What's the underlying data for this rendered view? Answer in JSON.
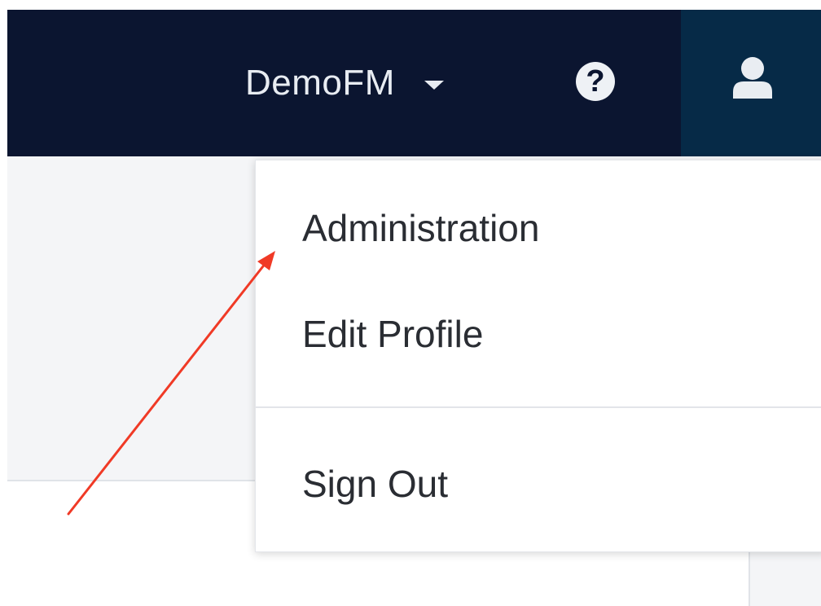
{
  "navbar": {
    "org_name": "DemoFM",
    "help_symbol": "?",
    "icons": {
      "dropdown": "caret-down-icon",
      "help": "question-circle-icon",
      "user": "user-icon"
    }
  },
  "user_menu": {
    "items": [
      {
        "label": "Administration"
      },
      {
        "label": "Edit Profile"
      },
      {
        "label": "Sign Out"
      }
    ]
  },
  "annotation": {
    "type": "arrow",
    "color": "#f03a26"
  },
  "colors": {
    "navbar_bg": "#0b1530",
    "user_button_bg": "#062a47",
    "content_bg": "#f4f5f7",
    "menu_text": "#2a2d33"
  }
}
